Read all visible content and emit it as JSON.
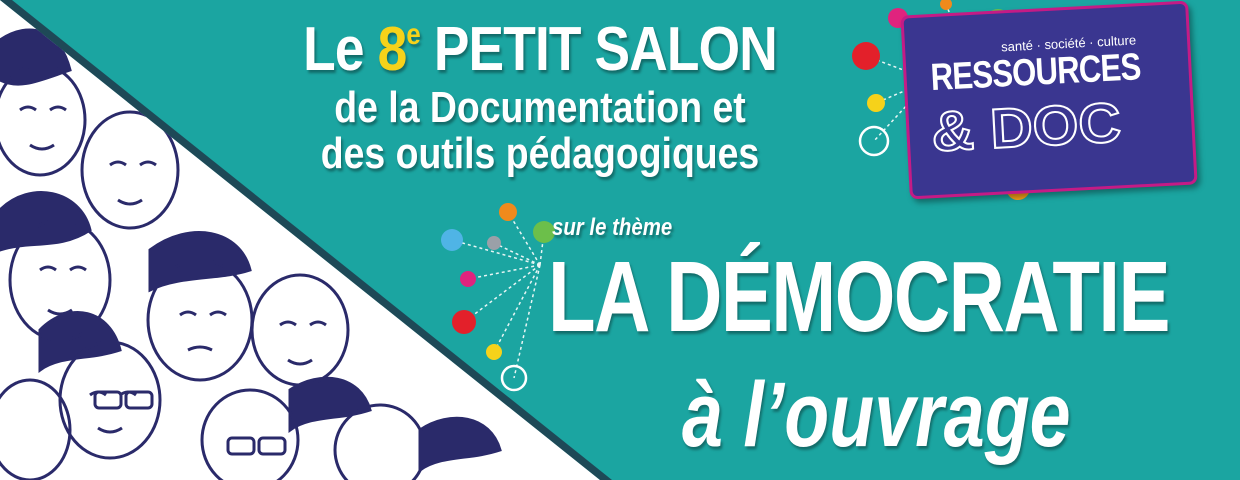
{
  "title": {
    "line1_prefix": "Le ",
    "line1_number": "8",
    "line1_sup": "e",
    "line1_suffix": " PETIT SALON",
    "line2": "de la Documentation et",
    "line3": "des outils pédagogiques"
  },
  "theme": {
    "intro": "sur le thème",
    "main": "LA DÉMOCRATIE",
    "sub": "à l’ouvrage"
  },
  "logo": {
    "tagline": "santé · société · culture",
    "name": "RESSOURCES",
    "amp_doc": "& DOC"
  },
  "colors": {
    "background": "#1ba5a1",
    "accent_yellow": "#f6d21a",
    "logo_bg": "#3a3690",
    "logo_border": "#c41b86",
    "illustration_ink": "#2a2a6a"
  }
}
